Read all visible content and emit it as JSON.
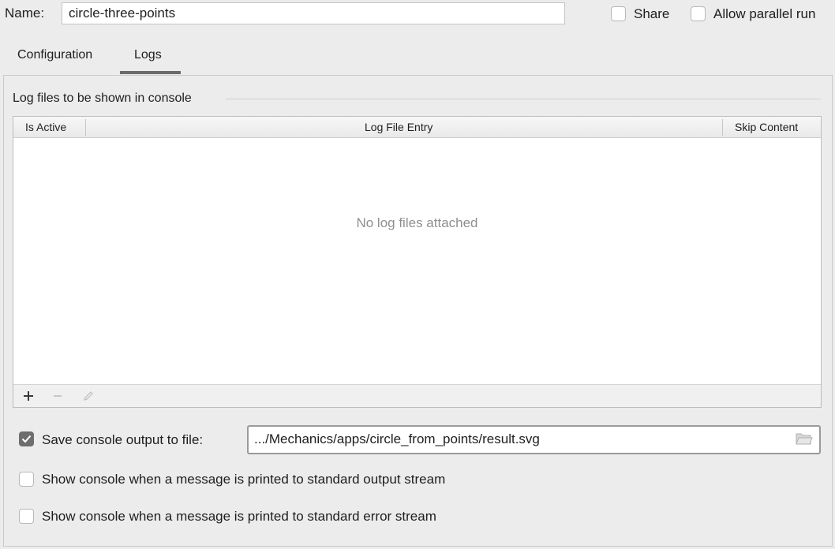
{
  "header": {
    "name_label": "Name:",
    "name_value": "circle-three-points",
    "share_label": "Share",
    "share_checked": false,
    "parallel_label": "Allow parallel run",
    "parallel_checked": false
  },
  "tabs": [
    {
      "label": "Configuration",
      "active": false
    },
    {
      "label": "Logs",
      "active": true
    }
  ],
  "logs": {
    "group_title": "Log files to be shown in console",
    "columns": [
      "Is Active",
      "Log File Entry",
      "Skip Content"
    ],
    "rows": [],
    "empty_text": "No log files attached",
    "toolbar": [
      "add-icon",
      "remove-icon",
      "edit-icon"
    ]
  },
  "save_output": {
    "checked": true,
    "label": "Save console output to file:",
    "path": ".../Mechanics/apps/circle_from_points/result.svg",
    "browse_icon": "folder-icon"
  },
  "options": [
    {
      "label": "Show console when a message is printed to standard output stream",
      "checked": false
    },
    {
      "label": "Show console when a message is printed to standard error stream",
      "checked": false
    }
  ],
  "colors": {
    "background": "#ececec",
    "checkbox_checked": "#6e6e6e",
    "placeholder_text": "#8f8f8f"
  }
}
